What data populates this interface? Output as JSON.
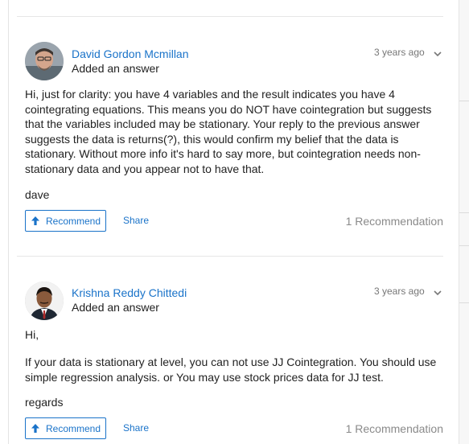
{
  "colors": {
    "link": "#1a73c9",
    "muted": "#8a8a8a",
    "divider": "#e6e6e6"
  },
  "icons": {
    "menu": "chevron-down-icon",
    "recommend": "arrow-up-icon"
  },
  "posts": [
    {
      "author": "David Gordon Mcmillan",
      "action": "Added an answer",
      "time": "3 years ago",
      "body": "Hi, just for clarity: you have 4 variables and the result indicates you have 4 cointegrating equations. This means you do NOT have cointegration but suggests that the variables included may be stationary. Your reply to the previous answer suggests the data is returns(?), this would confirm my belief that the data is stationary. Without more info it's hard to say more, but cointegration needs non-stationary data and you appear not to have that.",
      "signature": "dave",
      "recommend_label": "Recommend",
      "share_label": "Share",
      "recommendations": "1 Recommendation"
    },
    {
      "author": "Krishna Reddy Chittedi",
      "action": "Added an answer",
      "time": "3 years ago",
      "greeting": "Hi,",
      "body": "If your data is stationary at level, you can not use JJ Cointegration. You should use simple regression analysis. or You may use stock prices data for JJ test.",
      "signature": "regards",
      "recommend_label": "Recommend",
      "share_label": "Share",
      "recommendations": "1 Recommendation"
    }
  ]
}
